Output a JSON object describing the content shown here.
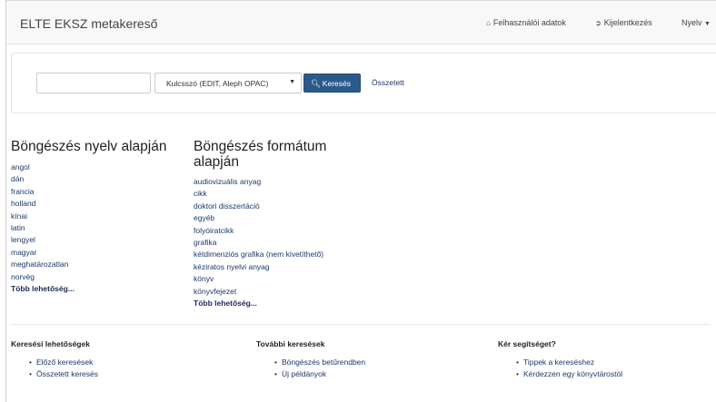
{
  "navbar": {
    "brand": "ELTE EKSZ metakereső",
    "user_data": "Felhasználói adatok",
    "logout": "Kijelentkezés",
    "language": "Nyelv"
  },
  "search": {
    "input_value": "",
    "select_value": "Kulcsszó (EDIT, Aleph OPAC)",
    "button_label": "Keresés",
    "advanced_label": "Összetett"
  },
  "browse_language": {
    "title": "Böngészés nyelv alapján",
    "items": [
      "angol",
      "dán",
      "francia",
      "holland",
      "kínai",
      "latin",
      "lengyel",
      "magyar",
      "meghatározatlan",
      "norvég"
    ],
    "more": "Több lehetőség..."
  },
  "browse_format": {
    "title_line1": "Böngészés formátum",
    "title_line2": "alapján",
    "items": [
      "audiovizuális anyag",
      "cikk",
      "doktori disszertáció",
      "egyéb",
      "folyóiratcikk",
      "grafika",
      "kétdimenziós grafika (nem kivetíthető)",
      "kéziratos nyelvi anyag",
      "könyv",
      "könyvfejezet"
    ],
    "more": "Több lehetőség..."
  },
  "footer": {
    "search_options": {
      "title": "Keresési lehetőségek",
      "items": [
        "Előző keresések",
        "Összetett keresés"
      ]
    },
    "more_searches": {
      "title": "További keresések",
      "items": [
        "Böngészés betűrendben",
        "Új példányok"
      ]
    },
    "help": {
      "title": "Kér segítséget?",
      "items": [
        "Tippek a kereséshez",
        "Kérdezzen egy könyvtárostól"
      ]
    }
  },
  "icons": {
    "user_data": "home-icon",
    "logout": "sign-out-icon",
    "language": "caret-down-icon",
    "search": "search-icon",
    "select": "caret-down-icon"
  }
}
